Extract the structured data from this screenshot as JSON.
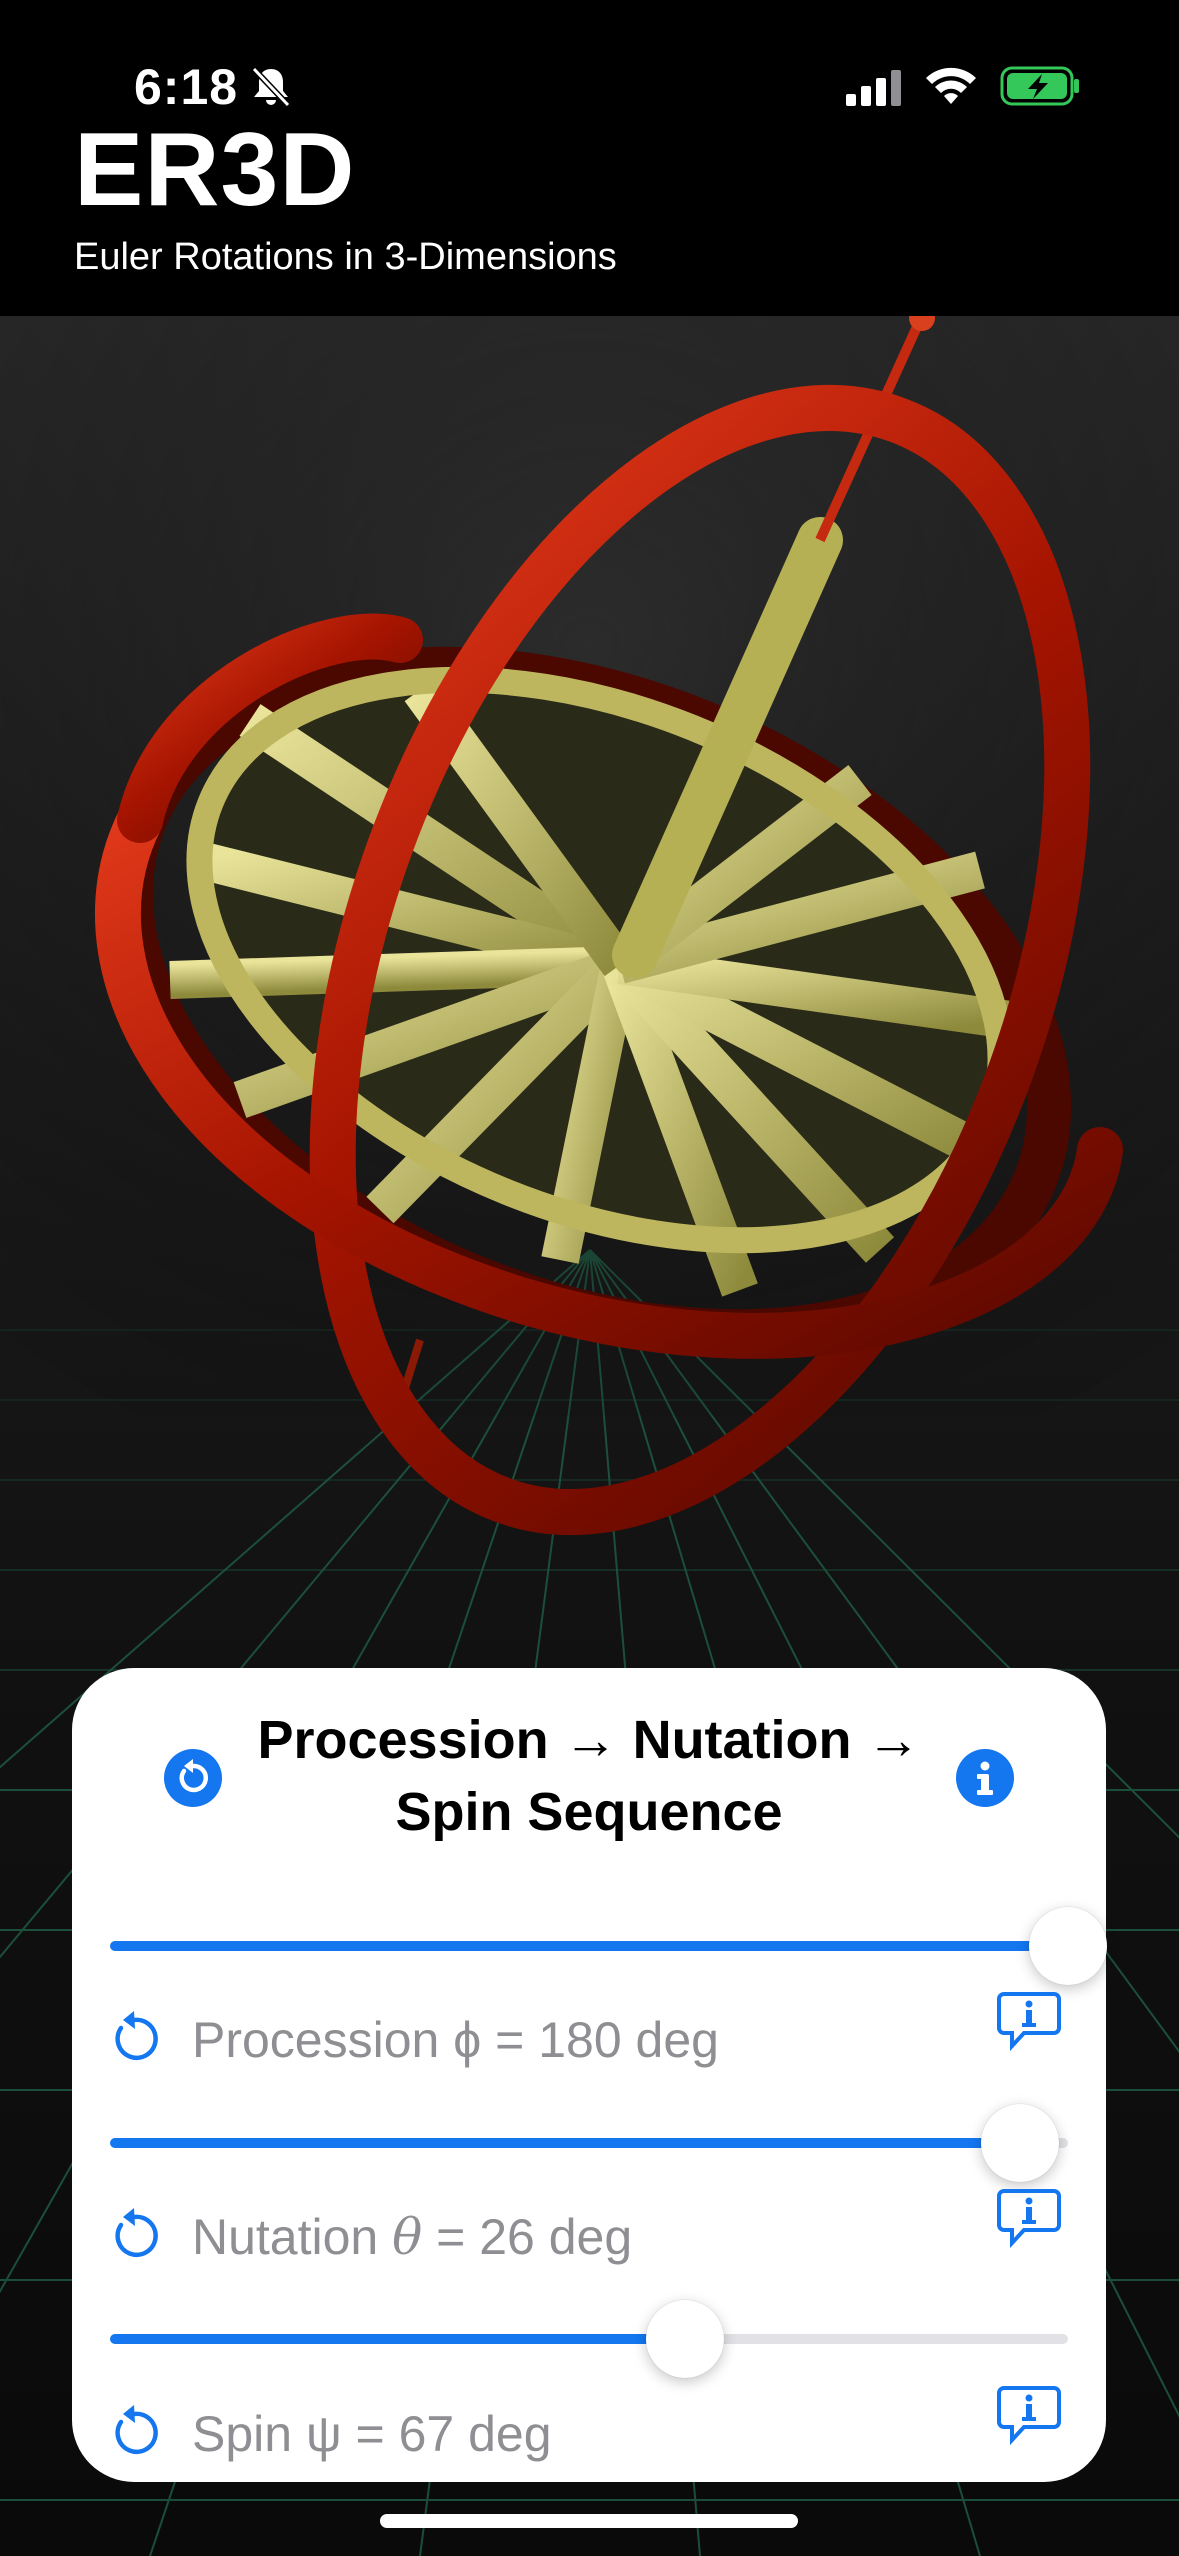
{
  "status_bar": {
    "time": "6:18",
    "icons": [
      "bell-slash-icon",
      "cellular-signal-icon",
      "wifi-icon",
      "battery-charging-icon"
    ],
    "battery_color": "#34c759"
  },
  "header": {
    "title": "ER3D",
    "subtitle": "Euler Rotations in 3-Dimensions"
  },
  "colors": {
    "accent": "#1477f0",
    "gimbal_ring": "#b11a00",
    "rotor": "#c9c36a",
    "grid": "#1f5c44"
  },
  "controls": {
    "title_line1": "Procession → Nutation →",
    "title_line2": "Spin Sequence",
    "reset_all_icon": "arrow-counterclockwise-icon",
    "info_icon": "info-circle-icon",
    "sliders": [
      {
        "label_prefix": "Procession ",
        "symbol": "ϕ",
        "label_suffix": " = 180 deg",
        "value_fraction": 1.0
      },
      {
        "label_prefix": "Nutation ",
        "symbol": "θ",
        "label_suffix": " = 26 deg",
        "value_fraction": 0.95
      },
      {
        "label_prefix": "Spin ",
        "symbol": "ψ",
        "label_suffix": " = 67 deg",
        "value_fraction": 0.6
      }
    ]
  }
}
